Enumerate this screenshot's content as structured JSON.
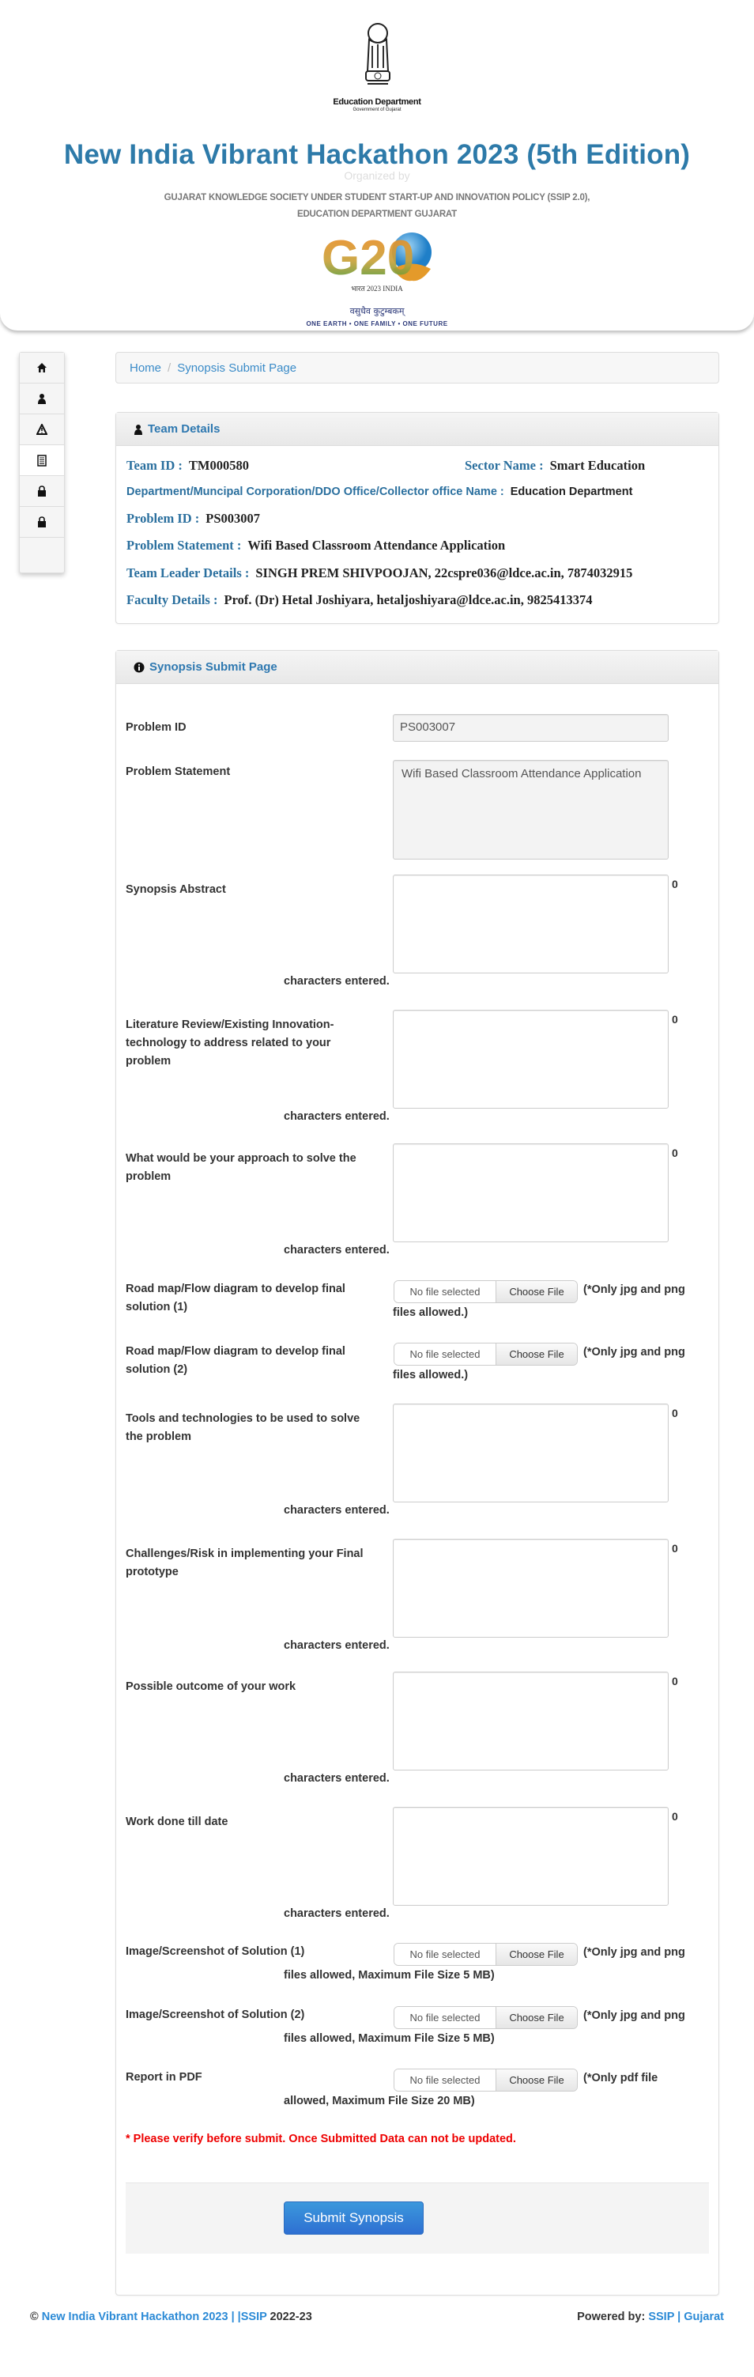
{
  "header": {
    "emblem_motto": "सत्यमेव जयते",
    "emblem_dept": "Education Department",
    "emblem_gov": "Government of Gujarat",
    "title": "New India Vibrant Hackathon 2023 (5th Edition)",
    "organized_by": "Organized by",
    "organizer_line1": "GUJARAT KNOWLEDGE SOCIETY UNDER STUDENT START-UP AND INNOVATION POLICY (SSIP 2.0),",
    "organizer_line2": "EDUCATION DEPARTMENT GUJARAT",
    "g20_text": "G20",
    "g20_sub": "भारत 2023 INDIA",
    "g20_motto": "वसुधैव कुटुम्बकम्",
    "g20_tagline": "ONE EARTH • ONE FAMILY • ONE FUTURE"
  },
  "sidebar": {
    "items": [
      {
        "icon": "home-icon"
      },
      {
        "icon": "user-icon"
      },
      {
        "icon": "warning-icon"
      },
      {
        "icon": "list-icon",
        "active": true
      },
      {
        "icon": "lock-icon"
      },
      {
        "icon": "lock-icon"
      }
    ]
  },
  "breadcrumb": {
    "home": "Home",
    "separator": "/",
    "current": "Synopsis Submit Page"
  },
  "team": {
    "title": "Team Details",
    "team_id_label": "Team ID :",
    "team_id": "TM000580",
    "sector_label": "Sector Name :",
    "sector": "Smart Education",
    "dept_label": "Department/Muncipal Corporation/DDO Office/Collector office Name :",
    "dept": "Education Department",
    "problem_id_label": "Problem ID :",
    "problem_id": "PS003007",
    "problem_statement_label": "Problem Statement :",
    "problem_statement": "Wifi Based Classroom Attendance Application",
    "leader_label": "Team Leader Details :",
    "leader": "SINGH PREM SHIVPOOJAN,  22cspre036@ldce.ac.in,  7874032915",
    "faculty_label": "Faculty Details :",
    "faculty": "Prof. (Dr) Hetal Joshiyara,  hetaljoshiyara@ldce.ac.in,  9825413374"
  },
  "form": {
    "title": "Synopsis Submit Page",
    "problem_id_label": "Problem ID",
    "problem_id_value": "PS003007",
    "problem_statement_label": "Problem Statement",
    "problem_statement_value": "Wifi Based Classroom Attendance Application",
    "chars_entered": "characters entered.",
    "textareas": [
      {
        "label": "Synopsis Abstract",
        "count": "0",
        "value": ""
      },
      {
        "label": "Literature Review/Existing Innovation-technology to address related to your problem",
        "count": "0",
        "value": ""
      },
      {
        "label": "What would be your approach to solve the problem",
        "count": "0",
        "value": ""
      },
      {
        "label": "Tools and technologies to be used to solve the problem",
        "count": "0",
        "value": ""
      },
      {
        "label": "Challenges/Risk in implementing your Final prototype",
        "count": "0",
        "value": ""
      },
      {
        "label": "Possible outcome of your work",
        "count": "0",
        "value": ""
      },
      {
        "label": "Work done till date",
        "count": "0",
        "value": ""
      }
    ],
    "file_no_file": "No file selected",
    "file_choose": "Choose File",
    "roadmaps": [
      {
        "label": "Road map/Flow diagram to develop final solution (1)",
        "note1": "(*Only jpg and png",
        "note2": "files allowed.)"
      },
      {
        "label": "Road map/Flow diagram to develop final solution (2)",
        "note1": "(*Only jpg and png",
        "note2": "files allowed.)"
      }
    ],
    "uploads": [
      {
        "label": "Image/Screenshot of Solution (1)",
        "note1": "(*Only jpg and png",
        "note2": "files allowed, Maximum File Size 5 MB)"
      },
      {
        "label": "Image/Screenshot of Solution (2)",
        "note1": "(*Only jpg and png",
        "note2": "files allowed, Maximum File Size 5 MB)"
      },
      {
        "label": "Report in PDF",
        "note1": "(*Only pdf file",
        "note2": "allowed, Maximum File Size 20 MB)"
      }
    ],
    "warning": "* Please verify before submit. Once Submitted Data can not be updated.",
    "submit_label": "Submit Synopsis"
  },
  "footer": {
    "copyright": "©",
    "site_link": "New India Vibrant Hackathon 2023 | |SSIP",
    "year": "2022-23",
    "powered_by": "Powered by:",
    "ssip_link": "SSIP",
    "sep": "|",
    "gujarat_link": "Gujarat"
  },
  "colors": {
    "accent": "#2d7aa9",
    "link": "#2b8ad6",
    "warning": "#e00000",
    "submit": "#2e7fd6"
  }
}
